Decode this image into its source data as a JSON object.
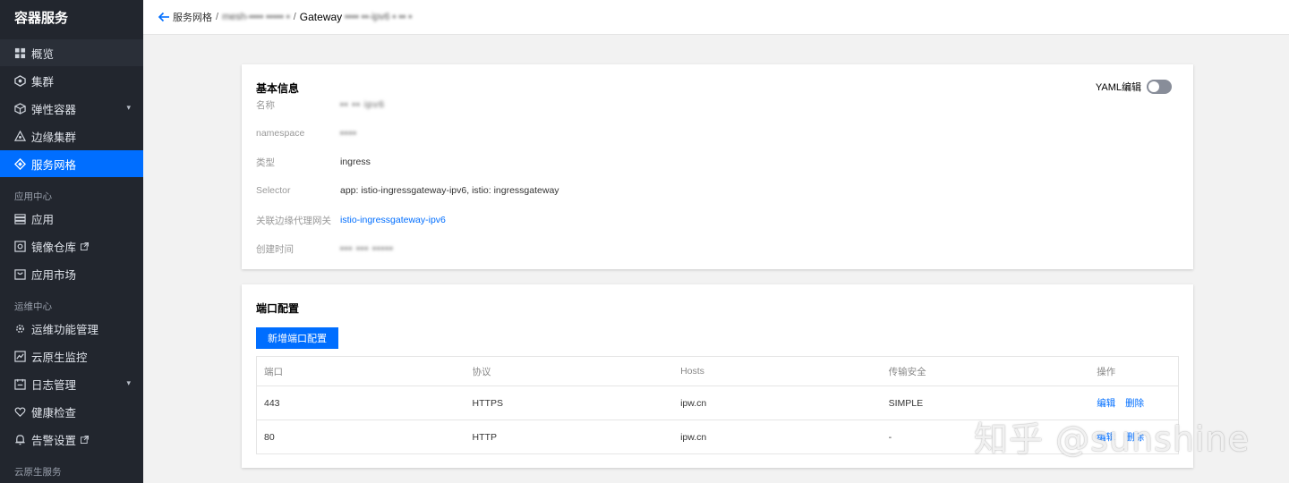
{
  "sidebar": {
    "brand": "容器服务",
    "items": [
      {
        "label": "概览",
        "icon": "dashboard-icon"
      },
      {
        "label": "集群",
        "icon": "cluster-icon"
      },
      {
        "label": "弹性容器",
        "icon": "elastic-container-icon"
      },
      {
        "label": "边缘集群",
        "icon": "edge-cluster-icon"
      },
      {
        "label": "服务网格",
        "icon": "service-mesh-icon"
      }
    ],
    "group_app": "应用中心",
    "app_items": [
      {
        "label": "应用",
        "icon": "app-icon"
      },
      {
        "label": "镜像仓库",
        "icon": "image-registry-icon"
      },
      {
        "label": "应用市场",
        "icon": "app-market-icon"
      }
    ],
    "group_ops": "运维中心",
    "ops_items": [
      {
        "label": "运维功能管理",
        "icon": "ops-management-icon"
      },
      {
        "label": "云原生监控",
        "icon": "monitor-icon"
      },
      {
        "label": "日志管理",
        "icon": "log-icon"
      },
      {
        "label": "健康检查",
        "icon": "health-check-icon"
      },
      {
        "label": "告警设置",
        "icon": "alarm-icon"
      }
    ],
    "group_cloud": "云原生服务"
  },
  "header": {
    "crumb_1": "服务网格",
    "crumb_2": "mesh-▪▪▪▪ ▪▪▪▪▪ ▪",
    "crumb_3": "Gateway",
    "crumb_3_blur": "▪▪▪▪ ▪▪-ipv6 ▪ ▪▪ ▪"
  },
  "basic_info": {
    "title": "基本信息",
    "yaml_label": "YAML编辑",
    "yaml_enabled": false,
    "rows": [
      {
        "label": "名称",
        "value": "▪▪ ▪▪ ipv6"
      },
      {
        "label": "namespace",
        "value": "▪▪▪▪"
      },
      {
        "label": "类型",
        "value": "ingress"
      },
      {
        "label": "Selector",
        "value": "app: istio-ingressgateway-ipv6, istio: ingressgateway"
      },
      {
        "label": "关联边缘代理网关",
        "value": "istio-ingressgateway-ipv6"
      },
      {
        "label": "创建时间",
        "value": "▪▪▪ ▪▪▪ ▪▪▪▪▪"
      }
    ]
  },
  "port_config": {
    "title": "端口配置",
    "add_button": "新增端口配置",
    "columns": [
      "端口",
      "协议",
      "Hosts",
      "传输安全",
      "操作"
    ],
    "rows": [
      {
        "port": "443",
        "protocol": "HTTPS",
        "hosts": "ipw.cn",
        "tls": "SIMPLE",
        "edit": "编辑",
        "delete": "删除"
      },
      {
        "port": "80",
        "protocol": "HTTP",
        "hosts": "ipw.cn",
        "tls": "-",
        "edit": "编辑",
        "delete": "删除"
      }
    ]
  },
  "watermark": "知乎 @sunshine",
  "colors": {
    "accent": "#006eff",
    "sidebar_bg": "#22262e",
    "page_bg": "#f2f2f2"
  }
}
